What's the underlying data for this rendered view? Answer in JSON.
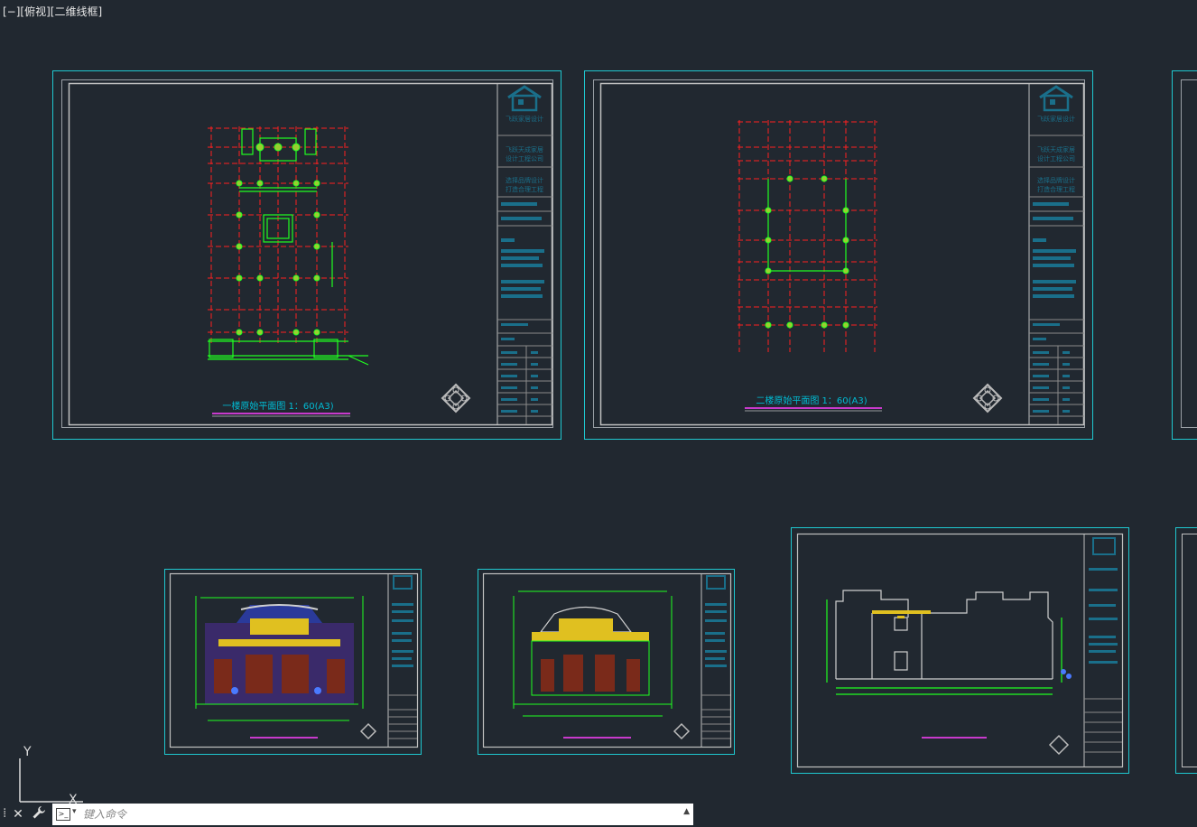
{
  "viewport": {
    "label": "[−][俯视][二维线框]"
  },
  "sheets": {
    "sheet1": {
      "title": "一楼原始平面图  1：60(A3)"
    },
    "sheet2": {
      "title": "二楼原始平面图  1：60(A3)"
    }
  },
  "title_block": {
    "company_logo_text": "飞跃家居设计",
    "company_line1": "飞跃天成家居",
    "company_line2": "设计工程公司",
    "slogan_line1": "选择品牌设计",
    "slogan_line2": "打造合理工程"
  },
  "ucs": {
    "y_label": "Y",
    "x_label": "X"
  },
  "command": {
    "placeholder": "键入命令",
    "close_glyph": "✕",
    "grip_glyph": "⁞"
  },
  "colors": {
    "background": "#212830",
    "sheet_border": "#1fc8d0",
    "grid_red": "#ff2020",
    "wall_green": "#20ff20",
    "title_cyan": "#00bcd4"
  }
}
